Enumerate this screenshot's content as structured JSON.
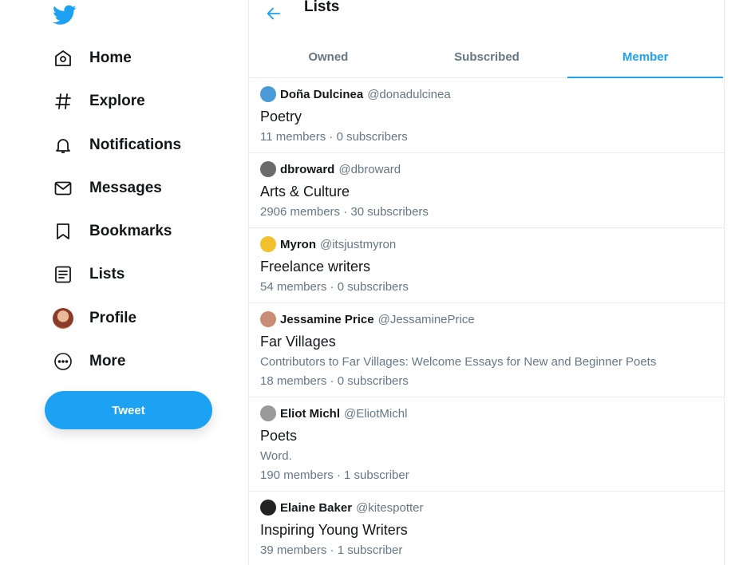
{
  "sidebar": {
    "logo": "bird-icon",
    "nav": [
      {
        "label": "Home",
        "icon": "home-icon"
      },
      {
        "label": "Explore",
        "icon": "hashtag-icon"
      },
      {
        "label": "Notifications",
        "icon": "bell-icon"
      },
      {
        "label": "Messages",
        "icon": "envelope-icon"
      },
      {
        "label": "Bookmarks",
        "icon": "bookmark-icon"
      },
      {
        "label": "Lists",
        "icon": "list-icon"
      },
      {
        "label": "Profile",
        "icon": "avatar"
      },
      {
        "label": "More",
        "icon": "more-icon"
      }
    ],
    "tweet_label": "Tweet"
  },
  "header": {
    "title": "Lists"
  },
  "tabs": [
    {
      "label": "Owned",
      "active": false
    },
    {
      "label": "Subscribed",
      "active": false
    },
    {
      "label": "Member",
      "active": true
    }
  ],
  "lists": [
    {
      "owner": "Doña Dulcinea",
      "handle": "@donadulcinea",
      "name": "Poetry",
      "description": "",
      "stats": "11 members · 0 subscribers",
      "avatar_color": "#4a9ad6"
    },
    {
      "owner": "dbroward",
      "handle": "@dbroward",
      "name": "Arts & Culture",
      "description": "",
      "stats": "2906 members · 30 subscribers",
      "avatar_color": "#6b6b6b"
    },
    {
      "owner": "Myron",
      "handle": "@itsjustmyron",
      "name": "Freelance writers",
      "description": "",
      "stats": "54 members · 0 subscribers",
      "avatar_color": "#f2c12e"
    },
    {
      "owner": "Jessamine Price",
      "handle": "@JessaminePrice",
      "name": "Far Villages",
      "description": "Contributors to Far Villages: Welcome Essays for New and Beginner Poets",
      "stats": "18 members · 0 subscribers",
      "avatar_color": "#c98d76"
    },
    {
      "owner": "Eliot Michl",
      "handle": "@EliotMichl",
      "name": "Poets",
      "description": "Word.",
      "stats": "190 members · 1 subscriber",
      "avatar_color": "#9a9a9a"
    },
    {
      "owner": "Elaine Baker",
      "handle": "@kitespotter",
      "name": "Inspiring Young Writers",
      "description": "",
      "stats": "39 members · 1 subscriber",
      "avatar_color": "#222222"
    }
  ],
  "colors": {
    "accent": "#1da1f2",
    "text": "#14171a",
    "secondary": "#657786",
    "border": "#e6ecf0"
  }
}
